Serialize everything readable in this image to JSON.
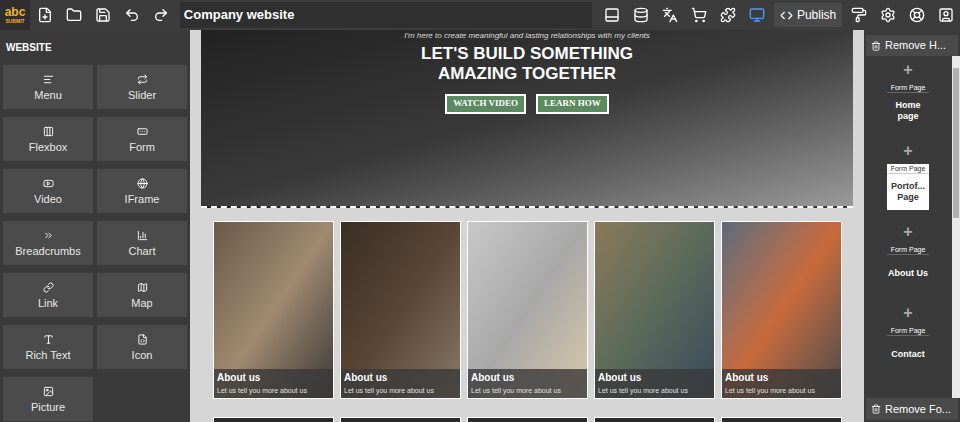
{
  "logo": {
    "top": "abc",
    "bottom": "SUBMIT"
  },
  "toolbar": {
    "title": "Company website",
    "publish": "Publish",
    "right_tools": [
      {
        "kind": "layout",
        "selected": false
      },
      {
        "kind": "database",
        "selected": false
      },
      {
        "kind": "translate",
        "selected": false
      },
      {
        "kind": "cart",
        "selected": false
      },
      {
        "kind": "plugins",
        "selected": false
      },
      {
        "kind": "desktop",
        "selected": true
      }
    ]
  },
  "sidebar": {
    "header": "WEBSITE",
    "items": [
      "Menu",
      "Slider",
      "Flexbox",
      "Form",
      "Video",
      "IFrame",
      "Breadcrumbs",
      "Chart",
      "Link",
      "Map",
      "Rich Text",
      "Icon",
      "Picture"
    ]
  },
  "hero": {
    "tagline": "I'm here to create meaningful and lasting relationships with my clients",
    "headline": [
      "LET'S BUILD SOMETHING",
      "AMAZING TOGETHER"
    ],
    "buttons": [
      "WATCH VIDEO",
      "LEARN HOW"
    ]
  },
  "cards": [
    {
      "title": "About us",
      "text": "Let us tell you more about us"
    },
    {
      "title": "About us",
      "text": "Let us tell you more about us"
    },
    {
      "title": "About us",
      "text": "Let us tell you more about us"
    },
    {
      "title": "About us",
      "text": "Let us tell you more about us"
    },
    {
      "title": "About us",
      "text": "Let us tell you more about us"
    }
  ],
  "pages_panel": {
    "remove_top": "Remove H...",
    "add": "+",
    "remove_bottom": "Remove Fo...",
    "pages": [
      {
        "type": "Form Page",
        "name": "Home page",
        "selected": false
      },
      {
        "type": "Form Page",
        "name": "Portof... Page",
        "selected": true
      },
      {
        "type": "Form Page",
        "name": "About Us",
        "selected": false
      },
      {
        "type": "Form Page",
        "name": "Contact",
        "selected": false
      }
    ]
  }
}
